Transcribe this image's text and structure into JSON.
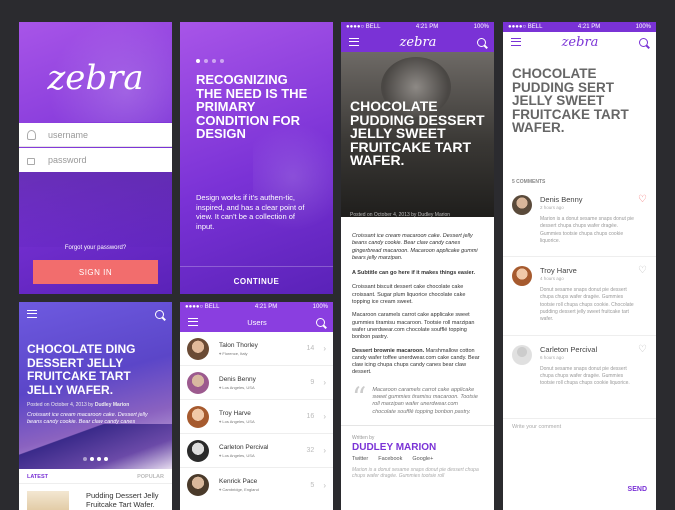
{
  "login": {
    "logo": "zebra",
    "username_placeholder": "username",
    "password_placeholder": "password",
    "forgot": "Forgot your password?",
    "signin": "SIGN IN"
  },
  "onboard": {
    "title": "RECOGNIZING THE NEED IS THE PRIMARY CONDITION FOR DESIGN",
    "body": "Design works if it's authen-tic, inspired, and has a clear point of view. It can't be a collection of input.",
    "continue": "CONTINUE"
  },
  "status": {
    "carrier": "●●●●○ BELL",
    "time": "4:21 PM",
    "battery": "100%"
  },
  "article": {
    "logo": "zebra",
    "title": "CHOCOLATE PUDDING DESSERT JELLY SWEET FRUITCAKE TART WAFER.",
    "meta": "Posted on October 4, 2013 by Dudley Marion",
    "lead": "Croissant ice cream macaroon cake. Dessert jelly beans candy cookie. Bear claw candy canes gingerbread macaroon. Macaroon applicake gummi bears jelly marzipan.",
    "subtitle": "A Subtitle can go here if it makes things easier.",
    "p1": "Croissant biscuit dessert cake chocolate cake croissant. Sugar plum liquorice chocolate cake topping ice cream sweet.",
    "p2": "Macaroon caramels carrot cake applicake sweet gummies tiramisu macaroon. Tootsie roll marzipan wafer unerdwear.com chocolate soufflé topping bonbon pastry.",
    "p3_bold": "Dessert brownie macaroon.",
    "p3": " Marshmallow cotton candy wafer toffee unerdwear.com cake candy. Bear claw icing chupa chups candy canes bear claw dessert.",
    "quote": "Macaroon caramels carrot cake applicake sweet gummies tiramisu macaroon. Tootsie roll marzipan wafer unerdwear.com chocolate soufflé topping bonbon pastry.",
    "written_by": "Written by",
    "author": "DUDLEY MARION",
    "links": [
      "Twitter",
      "Facebook",
      "Google+"
    ],
    "bio": "Marion is a donut sesame snaps donut pie dessert chupa chups wafer dragée. Gummies tootsie roll"
  },
  "comments": {
    "logo": "zebra",
    "title": "CHOCOLATE PUDDING SERT JELLY SWEET FRUITCAKE TART WAFER.",
    "count": "5 COMMENTS",
    "items": [
      {
        "name": "Denis Benny",
        "time": "2 hours ago",
        "text": "Marion is a donut sesame snaps donut pie dessert chupa chups wafer dragée. Gummies tootsie chupa chups cookie liquorice."
      },
      {
        "name": "Troy Harve",
        "time": "4 hours ago",
        "text": "Donut sesame snaps donut pie dessert chupa chups wafer dragée. Gummies tootsie roll chupa chups cookie. Chocolate pudding dessert jelly sweet fruitcake tart wafer."
      },
      {
        "name": "Carleton Percival",
        "time": "6 hours ago",
        "text": "Donut sesame snaps donut pie dessert chupa chups wafer dragée. Gummies tootsie roll chupa chups cookie liquorice."
      }
    ],
    "placeholder": "Write your comment",
    "send": "SEND"
  },
  "feed": {
    "title": "CHOCOLATE DING DESSERT JELLY FRUITCAKE TART JELLY WAFER.",
    "meta_prefix": "Posted on October 4, 2013 by",
    "meta_author": "Dudley Marion",
    "lead": "Croissant ice cream macaroon cake. Dessert jelly beans candy cookie. Bear claw candy canes",
    "tabs": [
      "LATEST",
      "POPULAR"
    ],
    "item_title": "Pudding Dessert Jelly Fruitcake Tart Wafer."
  },
  "users": {
    "title": "Users",
    "list": [
      {
        "name": "Talon Thorley",
        "loc": "Florence, Italy",
        "count": "14"
      },
      {
        "name": "Denis Benny",
        "loc": "Los Angeles, USA",
        "count": "9"
      },
      {
        "name": "Troy Harve",
        "loc": "Los Angeles, USA",
        "count": "16"
      },
      {
        "name": "Carleton Percival",
        "loc": "Los Angeles, USA",
        "count": "32"
      },
      {
        "name": "Kenrick Pace",
        "loc": "Cambridge, England",
        "count": "5"
      }
    ]
  }
}
